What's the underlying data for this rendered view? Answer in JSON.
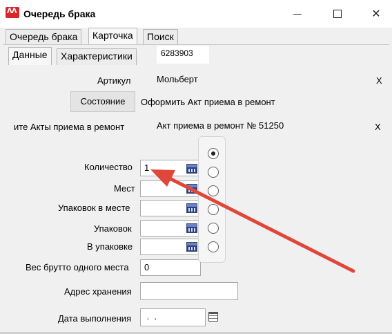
{
  "window": {
    "app_icon_text": "ᐱᐱ",
    "title": "Очередь брака",
    "minimize_icon": "minimize-icon",
    "maximize_icon": "maximize-icon",
    "close_glyph": "✕"
  },
  "tabs": {
    "top": [
      {
        "label": "Очередь брака",
        "active": false
      },
      {
        "label": "Карточка",
        "active": true
      },
      {
        "label": "Поиск",
        "active": false
      }
    ],
    "sub": [
      {
        "label": "Данные",
        "active": true
      },
      {
        "label": "Характеристики",
        "active": false
      }
    ]
  },
  "record_id": "6283903",
  "form": {
    "article_label": "Артикул",
    "article_value": "Мольберт",
    "article_clear": "X",
    "state_button": "Состояние",
    "state_value": "Оформить Акт приема в ремонт",
    "acts_label": "ите Акты приема в ремонт",
    "acts_value": "Акт приема в ремонт № 51250",
    "acts_clear": "X",
    "quantity_label": "Количество",
    "quantity_value": "1",
    "places_label": "Мест",
    "places_value": "",
    "packs_in_place_label": "Упаковок в месте",
    "packs_in_place_value": "",
    "packs_label": "Упаковок",
    "packs_value": "",
    "in_pack_label": "В упаковке",
    "in_pack_value": "",
    "gross_weight_label": "Вес брутто одного места",
    "gross_weight_value": "0",
    "storage_address_label": "Адрес хранения",
    "storage_address_value": "",
    "date_label": "Дата выполнения",
    "date_value": " .  ."
  },
  "radio_options": [
    true,
    false,
    false,
    false,
    false,
    false
  ],
  "annotation": {
    "color": "#e0463a"
  }
}
